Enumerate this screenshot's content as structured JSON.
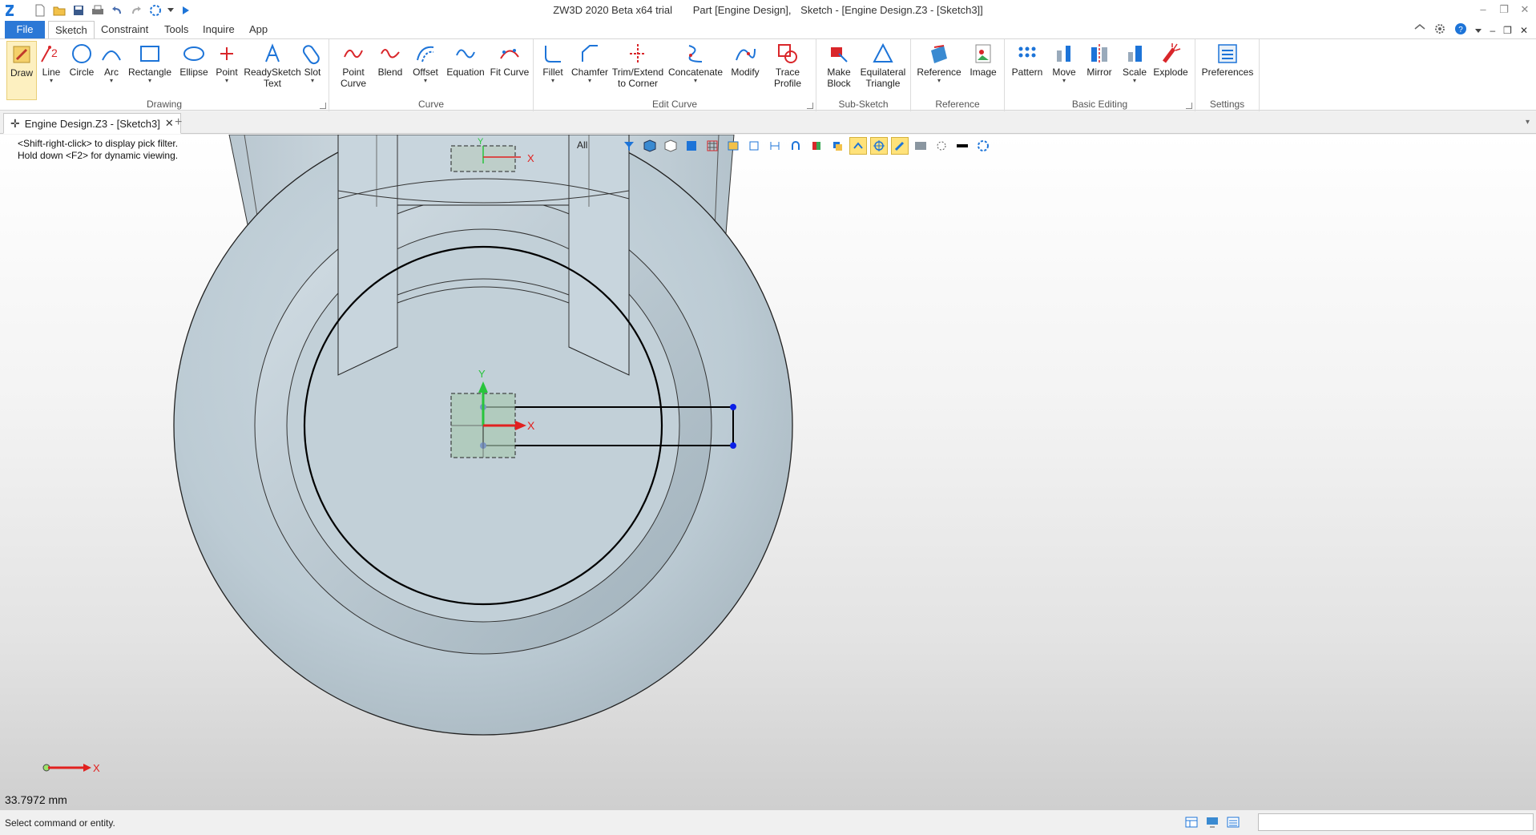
{
  "title": {
    "app": "ZW3D 2020 Beta x64 trial",
    "part": "Part [Engine Design],",
    "sketch": "Sketch - [Engine Design.Z3 - [Sketch3]]"
  },
  "menu": {
    "file": "File",
    "tabs": [
      "Sketch",
      "Constraint",
      "Tools",
      "Inquire",
      "App"
    ]
  },
  "ribbon": {
    "drawing": {
      "label": "Drawing",
      "draw": "Draw",
      "line": "Line",
      "circle": "Circle",
      "arc": "Arc",
      "rectangle": "Rectangle",
      "ellipse": "Ellipse",
      "point": "Point",
      "readysketch1": "ReadySketch",
      "readysketch2": "Text",
      "slot": "Slot"
    },
    "curve": {
      "label": "Curve",
      "pointcurve1": "Point",
      "pointcurve2": "Curve",
      "blend": "Blend",
      "offset": "Offset",
      "equation": "Equation",
      "fitcurve": "Fit Curve"
    },
    "editcurve": {
      "label": "Edit Curve",
      "fillet": "Fillet",
      "chamfer": "Chamfer",
      "trim1": "Trim/Extend",
      "trim2": "to Corner",
      "concatenate": "Concatenate",
      "modify": "Modify",
      "trace1": "Trace",
      "trace2": "Profile"
    },
    "subsketch": {
      "label": "Sub-Sketch",
      "makeblock1": "Make",
      "makeblock2": "Block",
      "eqtri1": "Equilateral",
      "eqtri2": "Triangle"
    },
    "reference": {
      "label": "Reference",
      "reference": "Reference",
      "image": "Image"
    },
    "basicediting": {
      "label": "Basic Editing",
      "pattern": "Pattern",
      "move": "Move",
      "mirror": "Mirror",
      "scale": "Scale",
      "explode": "Explode"
    },
    "settings": {
      "label": "Settings",
      "preferences": "Preferences"
    }
  },
  "doctab": {
    "label": "Engine Design.Z3 - [Sketch3]"
  },
  "viewport": {
    "hint1": "<Shift-right-click> to display pick filter.",
    "hint2": "Hold down <F2> for dynamic viewing.",
    "filter": "All",
    "axis_x": "X",
    "axis_y": "Y",
    "measure": "33.7972 mm"
  },
  "status": {
    "text": "Select command or entity.",
    "command_value": ""
  },
  "colors": {
    "accent": "#2b78d6",
    "ribbon_icon": "#1d74d8",
    "red_icon": "#d9262a",
    "part_fill": "#c5d3dc",
    "sketch_line": "#000000",
    "handle": "#0b1fe6"
  },
  "icons": [
    "new-icon",
    "open-icon",
    "save-icon",
    "print-icon",
    "undo-icon",
    "redo-icon",
    "wheel-icon",
    "run-icon",
    "home-icon",
    "gear-icon",
    "help-icon"
  ]
}
